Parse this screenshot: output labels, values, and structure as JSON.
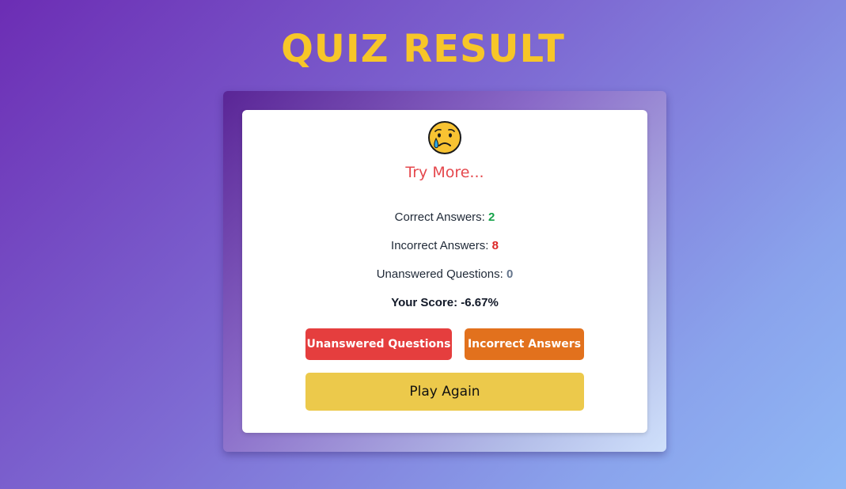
{
  "header": {
    "title": "QUIZ RESULT"
  },
  "result": {
    "emoji_icon": "crying-face-icon",
    "message": "Try More...",
    "correct_label": "Correct Answers: ",
    "correct_value": "2",
    "incorrect_label": "Incorrect Answers: ",
    "incorrect_value": "8",
    "unanswered_label": "Unanswered Questions: ",
    "unanswered_value": "0",
    "score_label": "Your Score: ",
    "score_value": "-6.67%"
  },
  "actions": {
    "unanswered_button": "Unanswered Questions",
    "incorrect_button": "Incorrect Answers",
    "play_again_button": "Play Again"
  },
  "colors": {
    "title": "#f7c628",
    "message": "#e5484d",
    "correct": "#16a34a",
    "incorrect": "#dc2626",
    "unanswered": "#64748b",
    "unanswered_button_bg": "#e53e3e",
    "incorrect_button_bg": "#e2711d",
    "play_again_bg": "#ecc94b"
  }
}
